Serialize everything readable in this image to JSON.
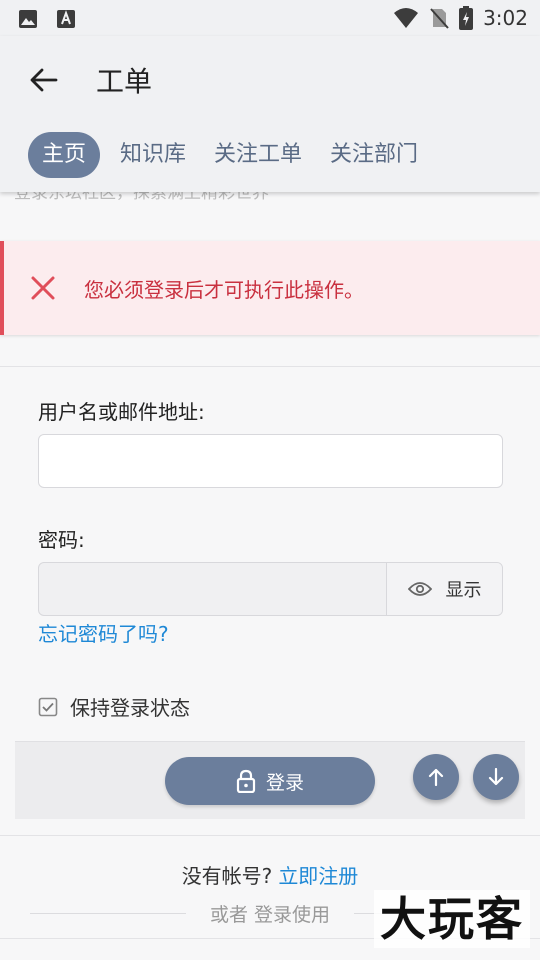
{
  "status_bar": {
    "time": "3:02"
  },
  "app_bar": {
    "title": "工单"
  },
  "tabs": [
    {
      "label": "主页",
      "active": true
    },
    {
      "label": "知识库",
      "active": false
    },
    {
      "label": "关注工单",
      "active": false
    },
    {
      "label": "关注部门",
      "active": false
    }
  ],
  "hint_text": "登录东坛社区，探索满上精彩世界",
  "alert": {
    "message": "您必须登录后才可执行此操作。",
    "color": "#c9303f"
  },
  "form": {
    "username_label": "用户名或邮件地址:",
    "username_value": "",
    "password_label": "密码:",
    "password_value": "",
    "show_label": "显示",
    "forgot_link": "忘记密码了吗?",
    "remember_label": "保持登录状态",
    "remember_checked": true,
    "login_label": "登录"
  },
  "register": {
    "prompt": "没有帐号?",
    "link": "立即注册"
  },
  "or_text": "或者 登录使用",
  "watermark": "大玩客",
  "colors": {
    "primary": "#6b7e9c",
    "link": "#1e88d6",
    "error": "#e04e5a"
  }
}
